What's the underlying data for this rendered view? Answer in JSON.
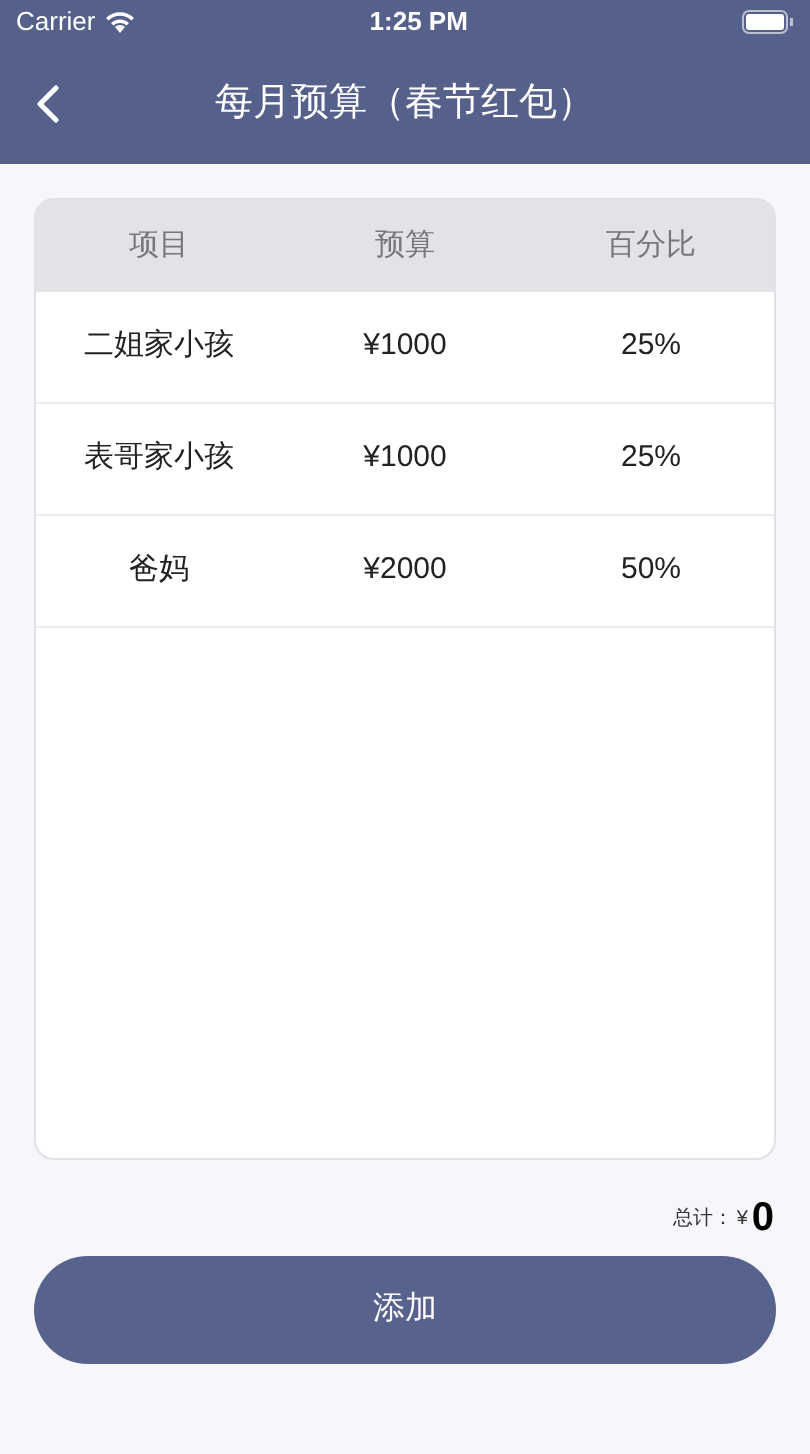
{
  "status_bar": {
    "carrier": "Carrier",
    "time": "1:25 PM"
  },
  "nav_bar": {
    "title": "每月预算（春节红包）"
  },
  "table": {
    "columns": [
      "项目",
      "预算",
      "百分比"
    ],
    "rows": [
      [
        "二姐家小孩",
        "¥1000",
        "25%"
      ],
      [
        "表哥家小孩",
        "¥1000",
        "25%"
      ],
      [
        "爸妈",
        "¥2000",
        "50%"
      ]
    ]
  },
  "total": {
    "label": "总计：",
    "currency": "¥",
    "amount": "0"
  },
  "add_button": {
    "label": "添加"
  }
}
